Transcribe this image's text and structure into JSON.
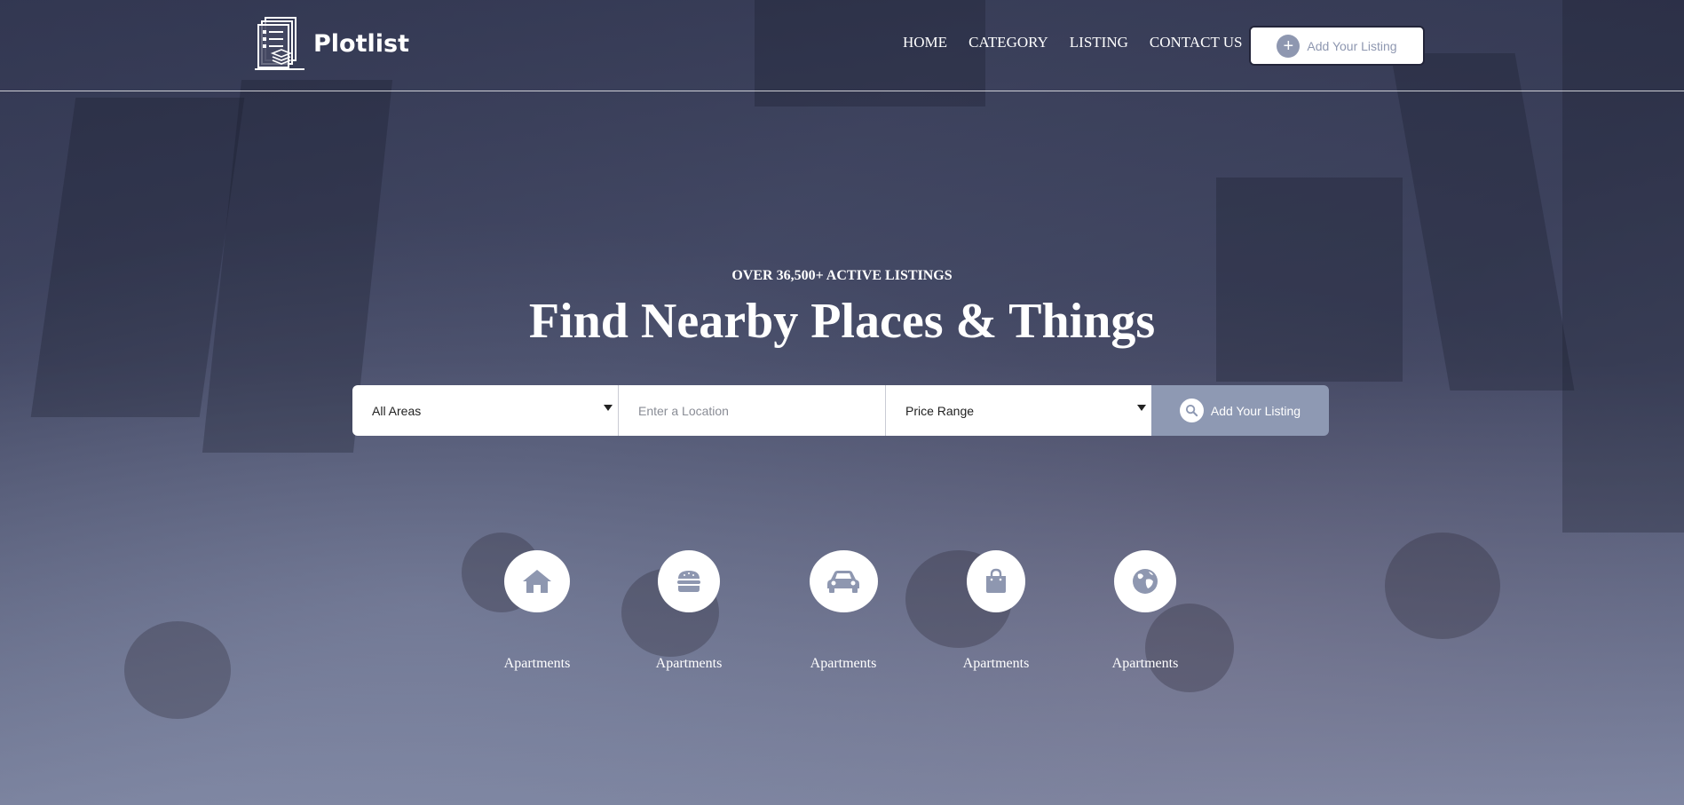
{
  "brand": {
    "name": "Plotlist"
  },
  "nav": {
    "items": [
      {
        "label": "HOME"
      },
      {
        "label": "CATEGORY"
      },
      {
        "label": "LISTING"
      },
      {
        "label": "CONTACT US"
      }
    ],
    "cta_label": "Add Your Listing",
    "cta_icon": "plus-icon"
  },
  "hero": {
    "eyebrow": "OVER 36,500+ ACTIVE LISTINGS",
    "headline": "Find Nearby Places & Things"
  },
  "search": {
    "area_selected": "All Areas",
    "location_placeholder": "Enter a Location",
    "price_selected": "Price Range",
    "button_label": "Add Your Listing",
    "button_icon": "search-icon"
  },
  "categories": [
    {
      "label": "Apartments",
      "icon": "home-icon"
    },
    {
      "label": "Apartments",
      "icon": "burger-icon"
    },
    {
      "label": "Apartments",
      "icon": "car-icon"
    },
    {
      "label": "Apartments",
      "icon": "shopping-bag-icon"
    },
    {
      "label": "Apartments",
      "icon": "globe-icon"
    }
  ],
  "colors": {
    "accent": "#8e99b3",
    "icon": "#8e97b0",
    "text_light": "#ffffff"
  }
}
